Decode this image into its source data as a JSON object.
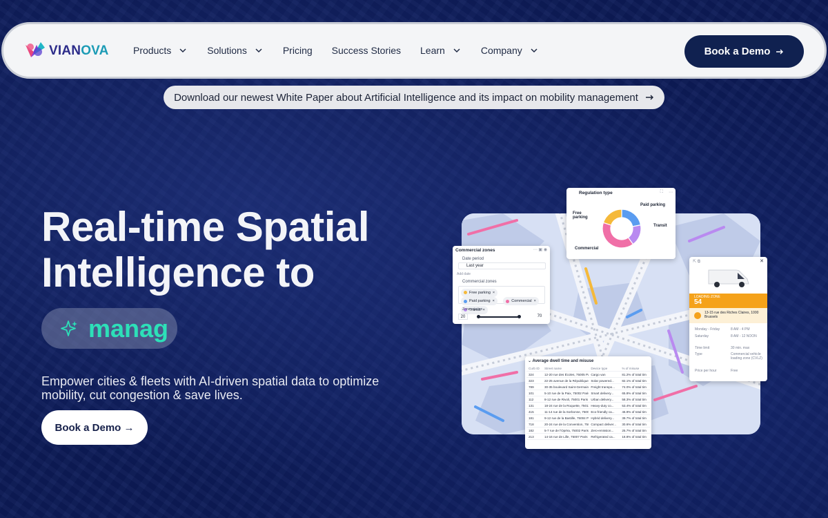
{
  "brand": {
    "name_a": "VIAN",
    "name_b": "OVA"
  },
  "nav": {
    "items": [
      {
        "label": "Products",
        "has_dropdown": true
      },
      {
        "label": "Solutions",
        "has_dropdown": true
      },
      {
        "label": "Pricing",
        "has_dropdown": false
      },
      {
        "label": "Success Stories",
        "has_dropdown": false
      },
      {
        "label": "Learn",
        "has_dropdown": true
      },
      {
        "label": "Company",
        "has_dropdown": true
      }
    ],
    "cta_label": "Book a Demo"
  },
  "banner": {
    "text": "Download our newest White Paper about Artificial Intelligence and its impact on mobility management"
  },
  "hero": {
    "headline_line1": "Real-time Spatial",
    "headline_line2": "Intelligence to",
    "typing_word": "manag",
    "subtext": "Empower cities & fleets with AI-driven spatial data to optimize mobility, cut congestion & save lives.",
    "cta_label": "Book a Demo →"
  },
  "regulation_card": {
    "title": "Regulation type",
    "labels": {
      "free": "Free parking",
      "paid": "Paid parking",
      "transit": "Transit",
      "commercial": "Commercial"
    },
    "slices": [
      {
        "name": "Paid parking",
        "value": 22,
        "color": "#5a9cf0"
      },
      {
        "name": "Transit",
        "value": 18,
        "color": "#b98af0"
      },
      {
        "name": "Commercial",
        "value": 40,
        "color": "#f06fa7"
      },
      {
        "name": "Free parking",
        "value": 20,
        "color": "#f5b93a"
      }
    ]
  },
  "zones_card": {
    "title": "Commercial zones",
    "date_period_label": "Date period",
    "date_value": "Last year",
    "add_date": "Add date",
    "zones_label": "Commercial zones",
    "chips": [
      {
        "label": "Free parking",
        "color": "#f5b93a"
      },
      {
        "label": "Paid parking",
        "color": "#5a9cf0"
      },
      {
        "label": "Commercial",
        "color": "#f06fa7"
      },
      {
        "label": "Transit",
        "color": "#b98af0"
      }
    ],
    "rotation_label": "Zone rotation",
    "range_min": "20",
    "range_max": "70"
  },
  "loading_card": {
    "zone_label": "LOADING ZONE",
    "zone_number": "54",
    "address": "13-15 rue des Riches Claires, 1000 Brussels",
    "hours": [
      {
        "day": "Monday - Friday",
        "time": "8 AM - 4 PM"
      },
      {
        "day": "Saturday",
        "time": "8 AM - 12 NOON"
      }
    ],
    "time_limit_label": "Time limit",
    "time_limit": "30 min. max",
    "type_label": "Type",
    "type_value": "Commercial vehicle loading zone (CVLZ)",
    "price_label": "Price per hour",
    "price_value": "Free"
  },
  "dwell_card": {
    "title": "Average dwell time and misuse",
    "columns": [
      "Curb ID",
      "Street name",
      "Device type",
      "% of misuse"
    ],
    "rows": [
      [
        "324",
        "12-20 rue des Écoles, 75005 Paris",
        "Cargo van",
        "81.2% of total tim"
      ],
      [
        "323",
        "22-25 avenue de la République, 75011 Paris",
        "Solar powered...",
        "82.1% of total tim"
      ],
      [
        "789",
        "30-35 boulevard Saint-Germain, 75006 Paris",
        "Freight transpo...",
        "74.0% of total tim"
      ],
      [
        "101",
        "5-10 rue de la Paix, 75002 Paris",
        "Smart delivery...",
        "65.8% of total tim"
      ],
      [
        "112",
        "8-12 rue de Rivoli, 75001 Paris",
        "Urban delivery...",
        "58.3% of total tim"
      ],
      [
        "131",
        "18-24 rue de la Roquette, 75011 Paris",
        "Heavy-duty co...",
        "53.4% of total tim"
      ],
      [
        "415",
        "11-14 rue de la Sorbonne, 75005 Paris",
        "Eco-friendly ca...",
        "46.9% of total tim"
      ],
      [
        "181",
        "9-12 rue de la Bastille, 75004 Paris",
        "Hybrid delivery...",
        "39.7% of total tim"
      ],
      [
        "718",
        "20-24 rue de la Convention, 75015 Paris",
        "Compact deliver...",
        "30.6% of total tim"
      ],
      [
        "182",
        "5-7 rue de l'Opéra, 75002 Paris",
        "Zero-emission...",
        "25.7% of total tim"
      ],
      [
        "213",
        "14-16 rue de Lille, 75007 Paris",
        "Refrigerated ca...",
        "18.8% of total tim"
      ]
    ]
  },
  "colors": {
    "navy": "#102150",
    "accent": "#2de0b8",
    "background": "#0b1a55"
  }
}
